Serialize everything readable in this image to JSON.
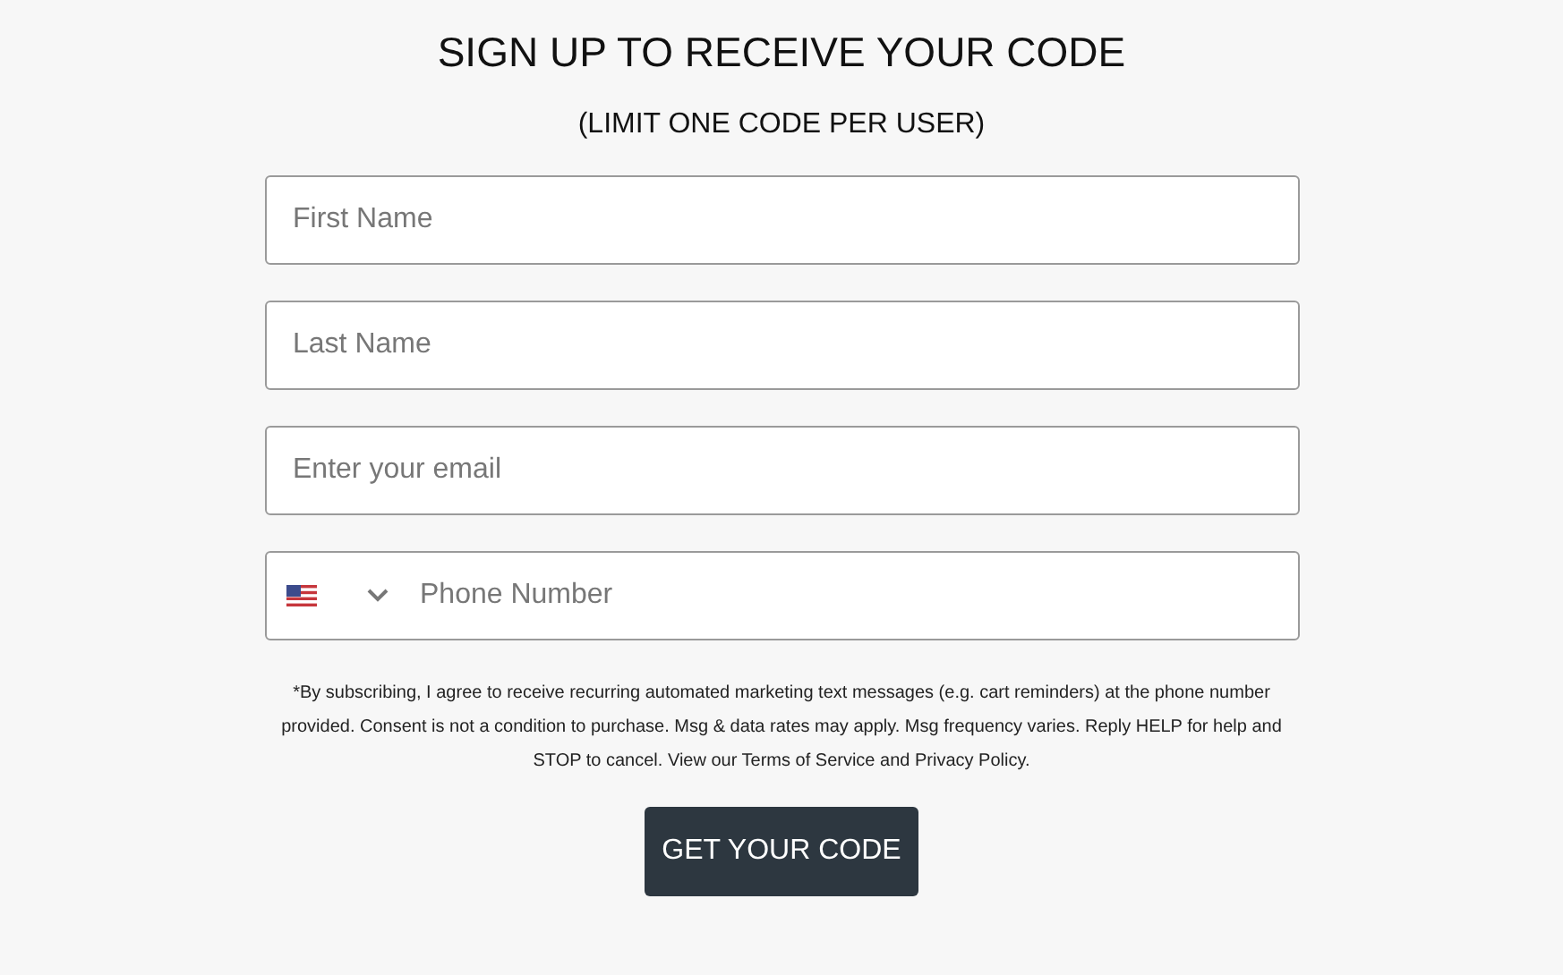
{
  "title": "SIGN UP TO RECEIVE YOUR CODE",
  "subtitle": "(LIMIT ONE CODE PER USER)",
  "fields": [
    {
      "kind": "text",
      "placeholder": "First Name"
    },
    {
      "kind": "text",
      "placeholder": "Last Name"
    },
    {
      "kind": "email",
      "placeholder": "Enter your email"
    },
    {
      "kind": "phone",
      "placeholder": "Phone Number"
    }
  ],
  "disclaimer": "*By subscribing, I agree to receive recurring automated marketing text messages (e.g. cart reminders) at the phone number provided. Consent is not a condition to purchase. Msg & data rates may apply. Msg frequency varies. Reply HELP for help and STOP to cancel. View our Terms of Service and Privacy Policy.",
  "button": "GET YOUR CODE"
}
